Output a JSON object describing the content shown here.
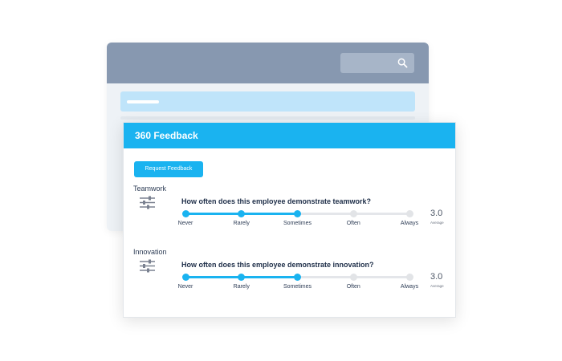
{
  "card": {
    "title": "360 Feedback",
    "request_button_label": "Request Feedback"
  },
  "scale_labels": [
    "Never",
    "Rarely",
    "Sometimes",
    "Often",
    "Always"
  ],
  "sections": [
    {
      "title": "Teamwork",
      "question": "How often does this employee demonstrate teamwork?",
      "score": "3.0",
      "score_label": "Average",
      "selected_level": 3,
      "max_level": 5
    },
    {
      "title": "Innovation",
      "question": "How often does this employee demonstrate innovation?",
      "score": "3.0",
      "score_label": "Average",
      "selected_level": 3,
      "max_level": 5
    }
  ],
  "colors": {
    "accent": "#1ab3f0",
    "header_bg": "#8798b0",
    "inactive_dot": "#e2e4e7"
  },
  "icons": {
    "search": "search-icon",
    "sliders": "sliders-icon"
  }
}
